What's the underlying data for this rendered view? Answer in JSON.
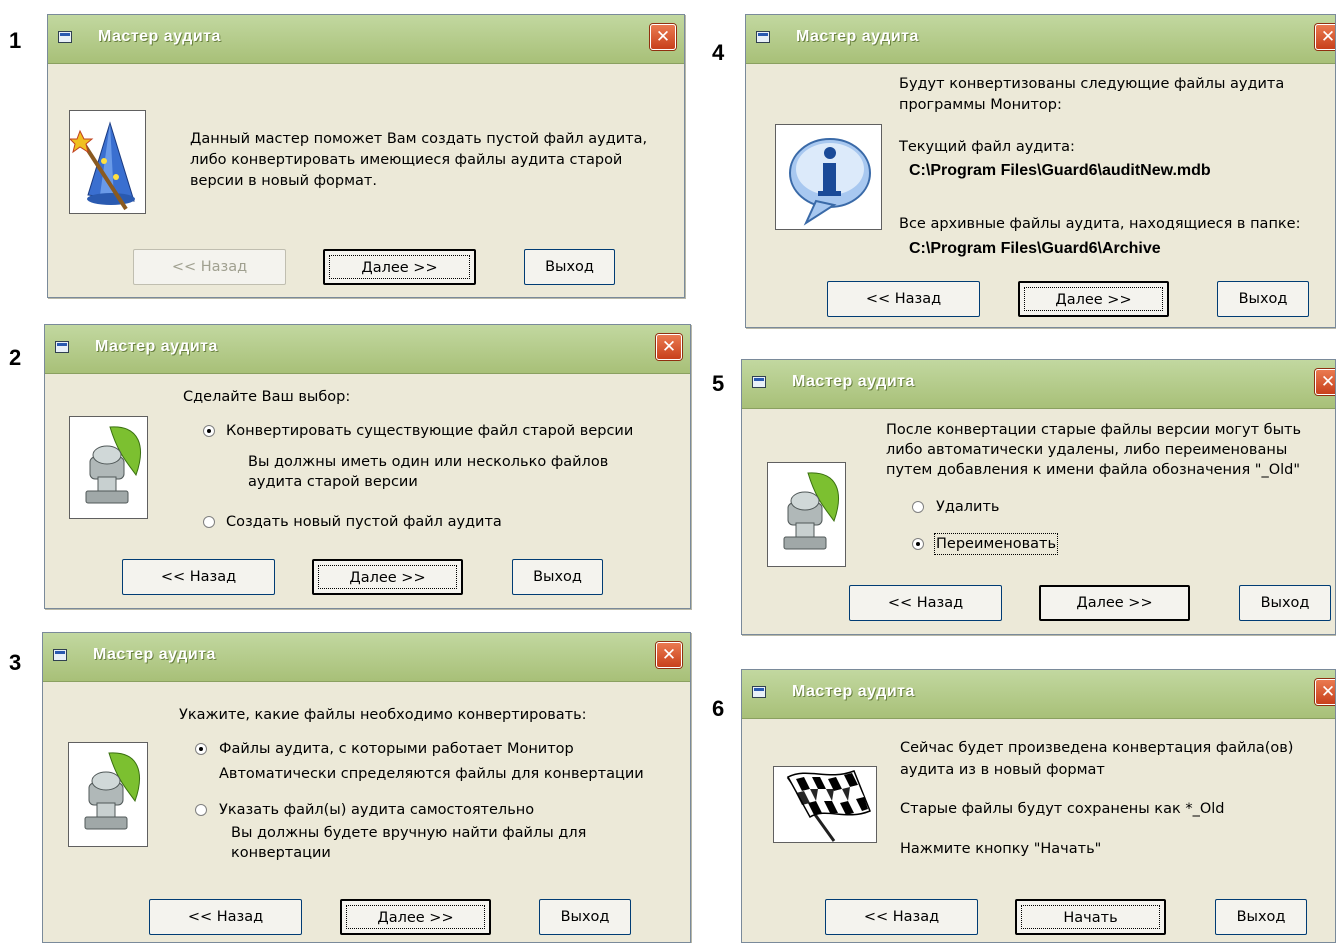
{
  "title": "Мастер аудита",
  "colors": {
    "titlebar": "#b5cc8c",
    "face": "#ece9d8",
    "close": "#d85a30"
  },
  "icons": {
    "title": "window-icon",
    "close": "close-icon",
    "wizard": "wizard-hat-icon",
    "gear": "gear-leaf-icon",
    "info": "info-icon",
    "flag": "checkered-flag-icon"
  },
  "buttons": {
    "back": "<< Назад",
    "next": "Далее >>",
    "exit": "Выход",
    "start": "Начать"
  },
  "close_glyph": "✕",
  "steps": [
    {
      "num": "1",
      "text": [
        "Данный мастер поможет Вам создать пустой файл аудита,",
        "либо конвертировать имеющиеся файлы аудита старой",
        "версии  в новый формат."
      ]
    },
    {
      "num": "2",
      "prompt": "Сделайте Ваш выбор:",
      "opt1": "Конвертировать существующие файл старой версии",
      "opt1_desc": [
        "Вы должны иметь один или несколько файлов",
        "аудита старой версии"
      ],
      "opt2": "Создать новый пустой файл аудита"
    },
    {
      "num": "3",
      "prompt": "Укажите, какие файлы необходимо конвертировать:",
      "opt1": "Файлы аудита, с которыми работает Монитор",
      "opt1_desc": "Автоматически спределяются файлы для конвертации",
      "opt2": "Указать файл(ы) аудита самостоятельно",
      "opt2_desc": [
        "Вы должны будете вручную найти файлы для",
        "конвертации"
      ]
    },
    {
      "num": "4",
      "intro": [
        "Будут конвертизованы следующие файлы аудита",
        "программы Монитор:"
      ],
      "current_label": "Текущий файл аудита:",
      "current_path": "C:\\Program Files\\Guard6\\auditNew.mdb",
      "archive_label": "Все архивные файлы аудита, находящиеся в папке:",
      "archive_path": "C:\\Program Files\\Guard6\\Archive"
    },
    {
      "num": "5",
      "text": [
        "После конвертации старые файлы версии  могут быть",
        "либо автоматически удалены, либо переименованы",
        "путем добавления к имени файла обозначения \"_Old\""
      ],
      "opt1": "Удалить",
      "opt2": "Переименовать"
    },
    {
      "num": "6",
      "line1": "Сейчас будет произведена конвертация файла(ов)",
      "line2": " аудита из в новый формат",
      "line3": "Старые файлы будут сохранены как *_Old",
      "line4": "Нажмите кнопку \"Начать\""
    }
  ]
}
